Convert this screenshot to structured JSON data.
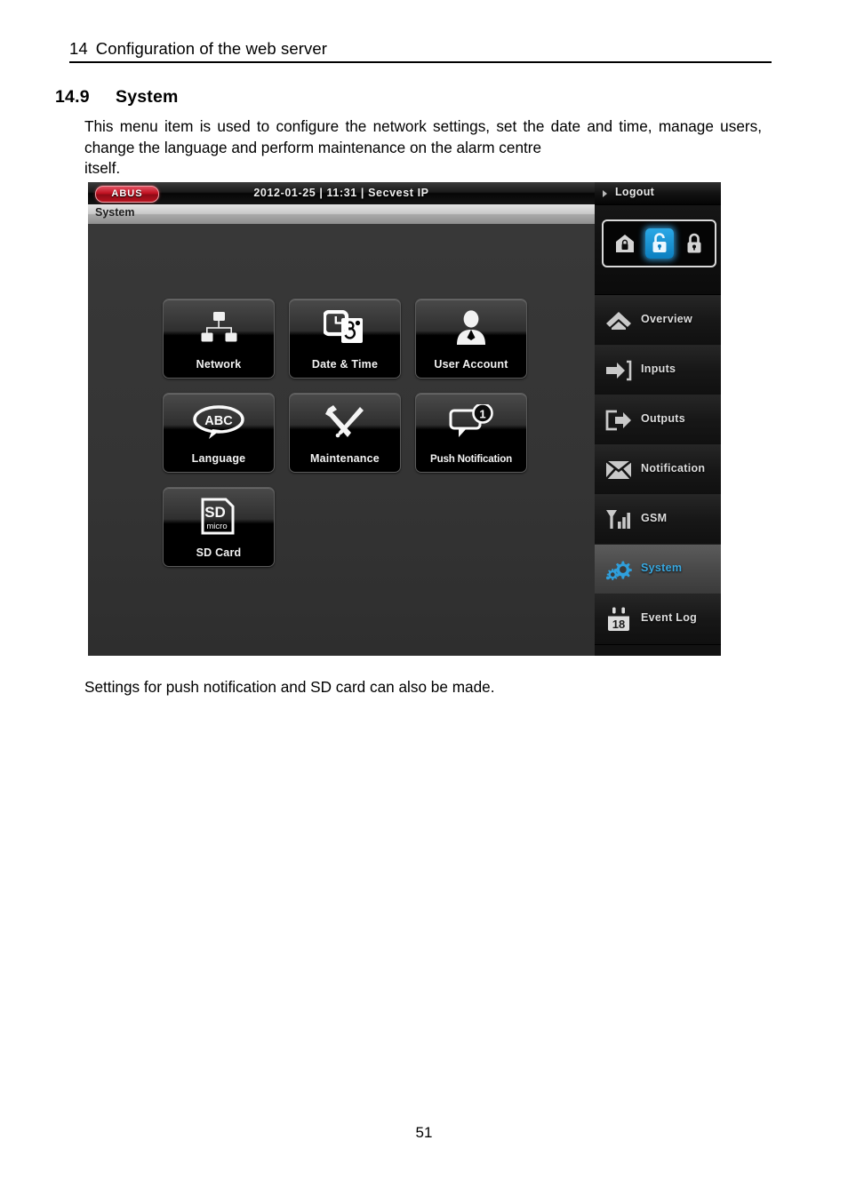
{
  "document": {
    "running_head_number": "14",
    "running_head_title": "Configuration of the web server",
    "section_number": "14.9",
    "section_title": "System",
    "body_paragraph": "This menu item is used to configure the network settings, set the date and time, manage users, change the language and perform maintenance on the alarm centre",
    "body_paragraph_last_line": "itself.",
    "caption_paragraph": "Settings for push notification and SD card can also be made.",
    "page_number": "51"
  },
  "screenshot": {
    "topbar": {
      "logo_text": "ABUS",
      "status_text": "2012-01-25  |  11:31  |  Secvest IP",
      "date": "2012-01-25",
      "time": "11:31",
      "device_name": "Secvest IP",
      "logout_label": "Logout"
    },
    "breadcrumb": "System",
    "lock_panel": {
      "buttons": [
        {
          "name": "part-set",
          "state": "inactive"
        },
        {
          "name": "unset",
          "state": "active"
        },
        {
          "name": "set",
          "state": "inactive"
        }
      ],
      "active_color": "#2aa8e6"
    },
    "tiles": [
      {
        "label": "Network",
        "icon": "network-tree-icon"
      },
      {
        "label": "Date & Time",
        "icon": "clock-calendar-icon",
        "calendar_day": "8"
      },
      {
        "label": "User Account",
        "icon": "person-icon"
      },
      {
        "label": "Language",
        "icon": "abc-speech-bubble-icon",
        "glyph": "ABC"
      },
      {
        "label": "Maintenance",
        "icon": "wrench-screwdriver-icon"
      },
      {
        "label": "Push Notification",
        "icon": "chat-bubble-icon",
        "badge": "1"
      },
      {
        "label": "SD Card",
        "icon": "sd-card-icon",
        "glyph": "SD",
        "sub_glyph": "micro"
      }
    ],
    "sidebar": [
      {
        "label": "Overview",
        "icon": "home-icon",
        "selected": false
      },
      {
        "label": "Inputs",
        "icon": "arrow-in-icon",
        "selected": false
      },
      {
        "label": "Outputs",
        "icon": "arrow-out-icon",
        "selected": false
      },
      {
        "label": "Notification",
        "icon": "envelope-icon",
        "selected": false
      },
      {
        "label": "GSM",
        "icon": "signal-bars-icon",
        "selected": false
      },
      {
        "label": "System",
        "icon": "gears-icon",
        "selected": true
      },
      {
        "label": "Event Log",
        "icon": "calendar-icon",
        "selected": false,
        "day": "18"
      }
    ],
    "selected_accent_color": "#39a8e0"
  }
}
